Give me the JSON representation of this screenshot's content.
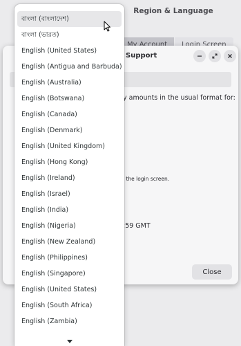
{
  "window": {
    "title": "Region & Language"
  },
  "tabs": {
    "my_account": "My Account",
    "login_screen": "Login Screen"
  },
  "dialog": {
    "title": "Support",
    "text_formats": "y amounts in the usual format for:",
    "text_login": "l the login screen.",
    "text_time": ":59 GMT",
    "close_label": "Close"
  },
  "language_list": [
    "বাংলা (বাংলাদেশ)",
    "বাংলা (ভারত)",
    "English (United States)",
    "English (Antigua and Barbuda)",
    "English (Australia)",
    "English (Botswana)",
    "English (Canada)",
    "English (Denmark)",
    "English (United Kingdom)",
    "English (Hong Kong)",
    "English (Ireland)",
    "English (Israel)",
    "English (India)",
    "English (Nigeria)",
    "English (New Zealand)",
    "English (Philippines)",
    "English (Singapore)",
    "English (United States)",
    "English (South Africa)",
    "English (Zambia)"
  ],
  "selected_index": 0,
  "icons": {
    "minimize": "minimize-icon",
    "maximize": "maximize-icon",
    "close": "close-icon",
    "scroll_down": "scroll-down-arrow-icon",
    "cursor": "mouse-pointer-icon"
  }
}
